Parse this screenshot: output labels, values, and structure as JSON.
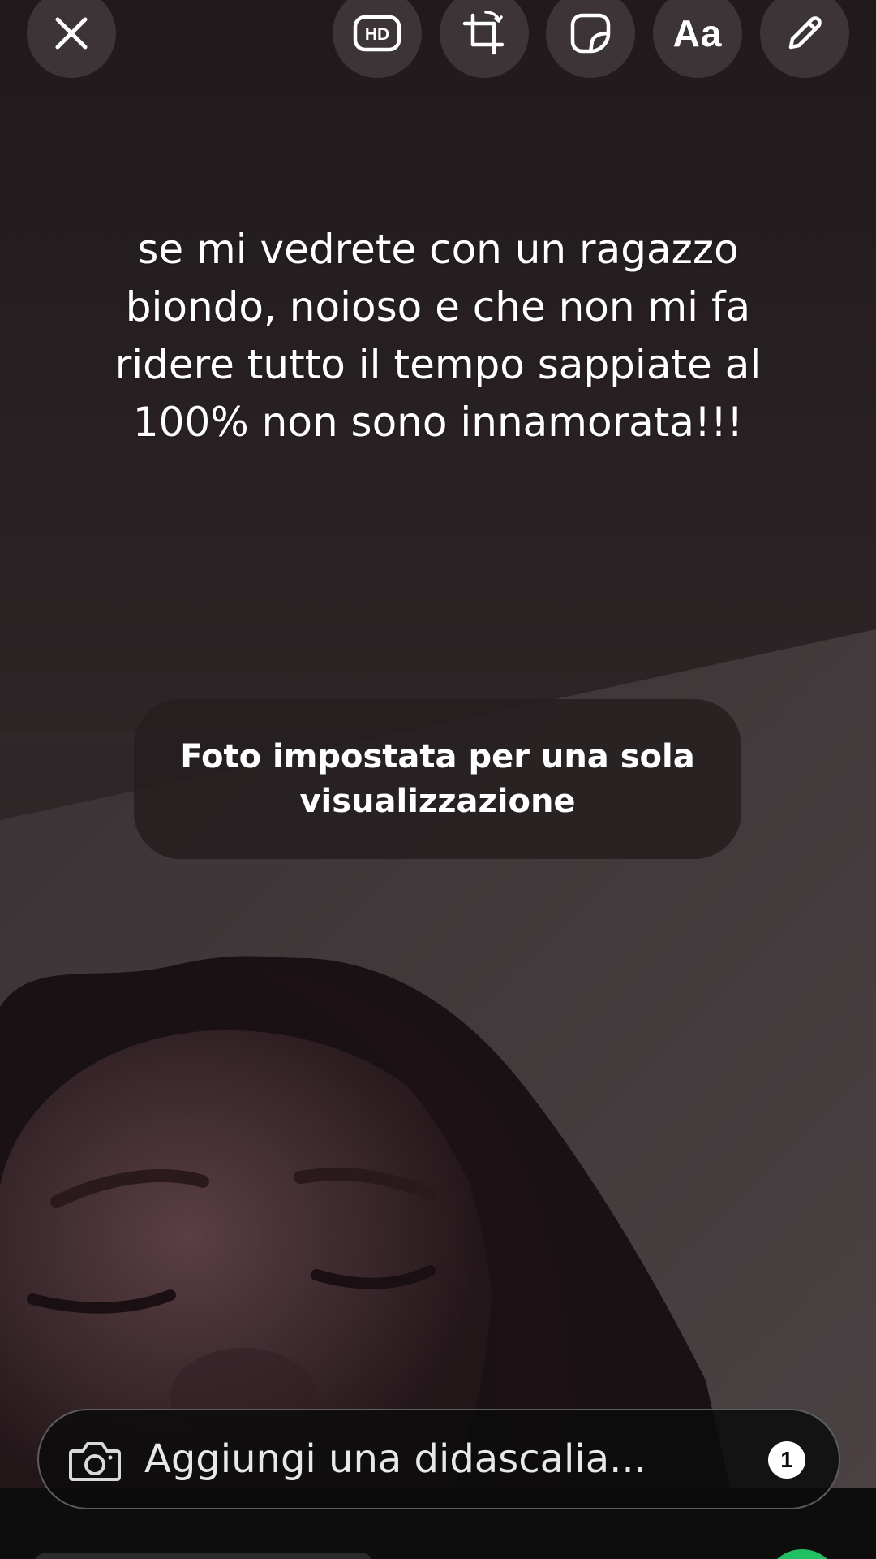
{
  "toolbar": {
    "close_icon": "close-icon",
    "hd_label": "HD",
    "crop_icon": "crop-rotate-icon",
    "sticker_icon": "sticker-icon",
    "text_tool_label": "Aa",
    "draw_icon": "pencil-icon"
  },
  "overlay_text": "se mi vedrete con un ragazzo biondo, noioso e che non mi fa ridere tutto il tempo sappiate al 100% non sono innamorata!!!",
  "view_once_toast": "Foto impostata per una sola visualizzazione",
  "caption": {
    "placeholder": "Aggiungi una didascalia...",
    "value": "",
    "camera_icon": "camera-icon",
    "view_once_label": "1"
  },
  "colors": {
    "send_accent": "#21c063",
    "toolbar_button_bg": "#463e40",
    "toast_bg": "#241f20"
  }
}
